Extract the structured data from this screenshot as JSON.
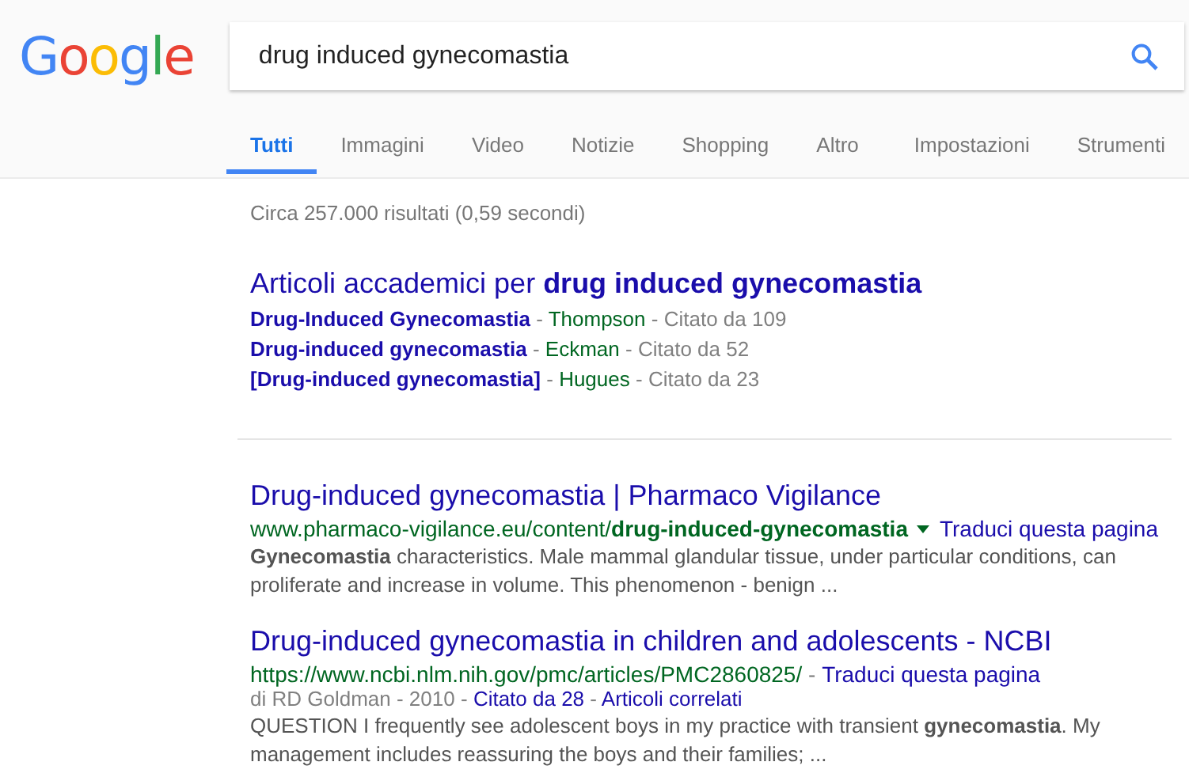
{
  "logo": "Google",
  "search": {
    "value": "drug induced gynecomastia"
  },
  "tabs": [
    {
      "label": "Tutti",
      "selected": true
    },
    {
      "label": "Immagini",
      "selected": false
    },
    {
      "label": "Video",
      "selected": false
    },
    {
      "label": "Notizie",
      "selected": false
    },
    {
      "label": "Shopping",
      "selected": false
    },
    {
      "label": "Altro",
      "selected": false
    }
  ],
  "tools": [
    "Impostazioni",
    "Strumenti"
  ],
  "stats": "Circa 257.000 risultati (0,59 secondi)",
  "scholar": {
    "title": "Articoli accademici per **drug induced gynecomastia**",
    "rows": [
      {
        "title": "Drug-Induced Gynecomastia",
        "separators": [
          "-",
          "-"
        ],
        "author": "Thompson",
        "cited": "Citato da 109"
      },
      {
        "title": "Drug-induced gynecomastia",
        "separators": [
          "-",
          "-"
        ],
        "author": "Eckman",
        "cited": "Citato da 52"
      },
      {
        "title": "[Drug-induced gynecomastia]",
        "separators": [
          "-",
          "-"
        ],
        "author": "Hugues",
        "cited": "Citato da 23"
      }
    ]
  },
  "results": [
    {
      "title": "Drug-induced gynecomastia | Pharmaco Vigilance",
      "url": "www.pharmaco-vigilance.eu/content/**drug-induced-gynecomastia**",
      "url_menu": true,
      "translate": "Traduci questa pagina",
      "snippet": "**Gynecomastia** characteristics. Male mammal glandular tissue, under particular conditions, can proliferate and increase in volume. This phenomenon - benign ..."
    },
    {
      "title": "Drug-induced gynecomastia in children and adolescents - NCBI",
      "url": "https://www.ncbi.nlm.nih.gov/pmc/articles/PMC2860825/",
      "url_menu": false,
      "url_separator": "-",
      "translate": "Traduci questa pagina",
      "meta": {
        "byline": "di RD Goldman - 2010",
        "separators": [
          "-",
          "-"
        ],
        "cited": "Citato da 28",
        "related": "Articoli correlati"
      },
      "snippet": "QUESTION I frequently see adolescent boys in my practice with transient **gynecomastia**. My management includes reassuring the boys and their families; ..."
    }
  ]
}
